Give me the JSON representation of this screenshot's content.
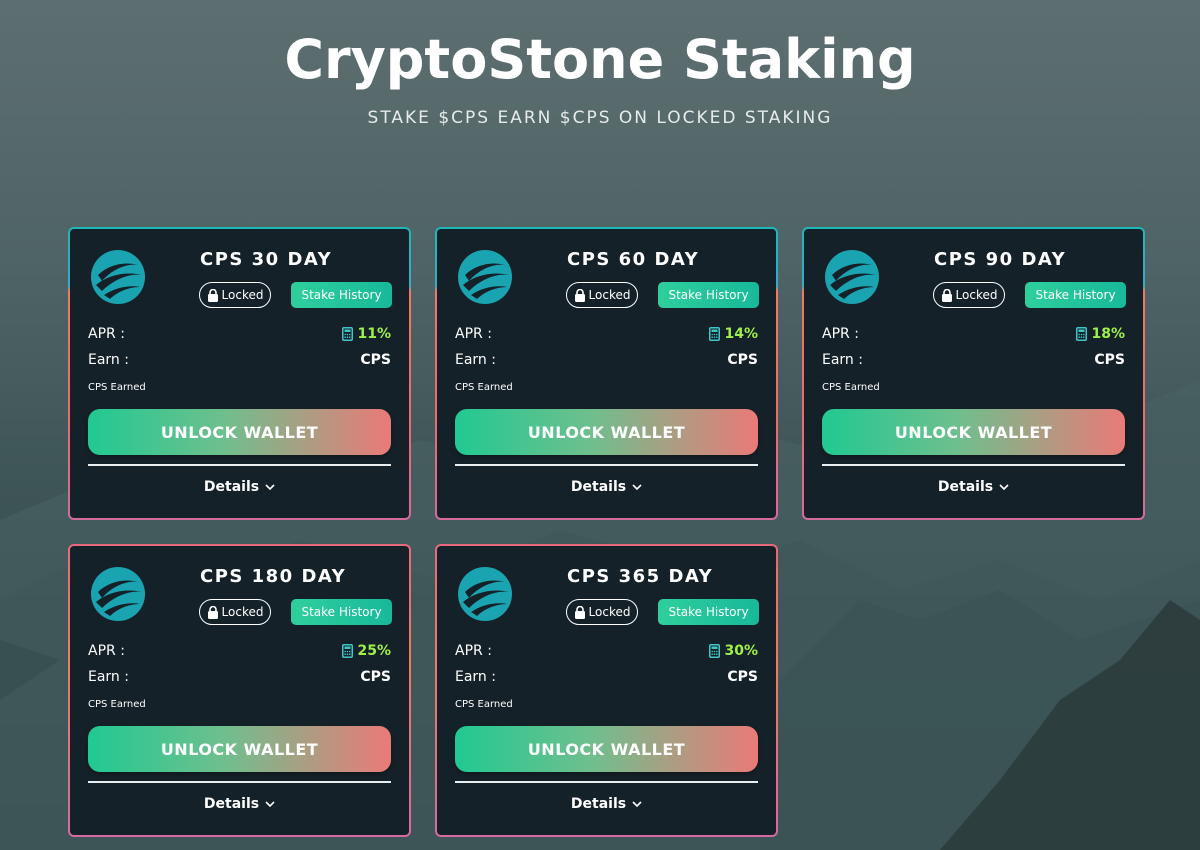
{
  "header": {
    "title": "CryptoStone Staking",
    "subtitle": "Stake $CPS Earn $CPS on Locked Staking"
  },
  "colors": {
    "accent_green": "#21c992",
    "accent_coral": "#ea7a78",
    "apr_green": "#9ef04a",
    "card_bg": "#152128"
  },
  "icons": [
    "cryptostone-logo",
    "lock-icon",
    "calculator-icon",
    "chevron-down-icon"
  ],
  "pools": [
    {
      "title": "CPS 30 DAY",
      "locked_label": "Locked",
      "history_label": "Stake History",
      "apr_label": "APR :",
      "apr_value": "11%",
      "earn_label": "Earn :",
      "earn_value": "CPS",
      "earned_label": "CPS Earned",
      "unlock_label": "UNLOCK WALLET",
      "details_label": "Details"
    },
    {
      "title": "CPS 60 DAY",
      "locked_label": "Locked",
      "history_label": "Stake History",
      "apr_label": "APR :",
      "apr_value": "14%",
      "earn_label": "Earn :",
      "earn_value": "CPS",
      "earned_label": "CPS Earned",
      "unlock_label": "UNLOCK WALLET",
      "details_label": "Details"
    },
    {
      "title": "CPS 90 DAY",
      "locked_label": "Locked",
      "history_label": "Stake History",
      "apr_label": "APR :",
      "apr_value": "18%",
      "earn_label": "Earn :",
      "earn_value": "CPS",
      "earned_label": "CPS Earned",
      "unlock_label": "UNLOCK WALLET",
      "details_label": "Details"
    },
    {
      "title": "CPS 180 DAY",
      "locked_label": "Locked",
      "history_label": "Stake History",
      "apr_label": "APR :",
      "apr_value": "25%",
      "earn_label": "Earn :",
      "earn_value": "CPS",
      "earned_label": "CPS Earned",
      "unlock_label": "UNLOCK WALLET",
      "details_label": "Details"
    },
    {
      "title": "CPS 365 DAY",
      "locked_label": "Locked",
      "history_label": "Stake History",
      "apr_label": "APR :",
      "apr_value": "30%",
      "earn_label": "Earn :",
      "earn_value": "CPS",
      "earned_label": "CPS Earned",
      "unlock_label": "UNLOCK WALLET",
      "details_label": "Details"
    }
  ]
}
